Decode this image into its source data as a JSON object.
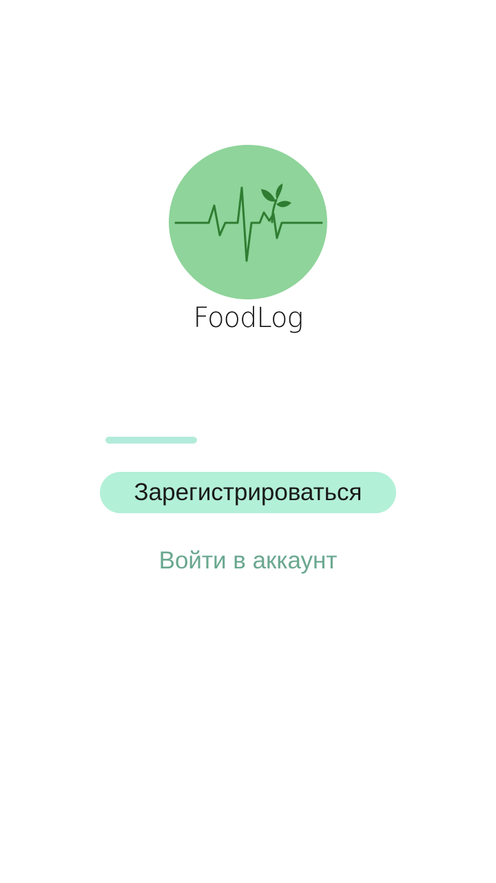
{
  "logo": {
    "icon": "heartbeat-leaf-icon",
    "circle_color": "#8fd49a",
    "line_color": "#2f7d32"
  },
  "app": {
    "name": "FoodLog"
  },
  "loading": {
    "progress": 1.0,
    "fill_color": "#b3ebda"
  },
  "actions": {
    "register_label": "Зарегистрироваться",
    "login_label": "Войти в аккаунт"
  },
  "colors": {
    "accent": "#b3f0d8",
    "link": "#6aa890",
    "background": "#ffffff"
  }
}
